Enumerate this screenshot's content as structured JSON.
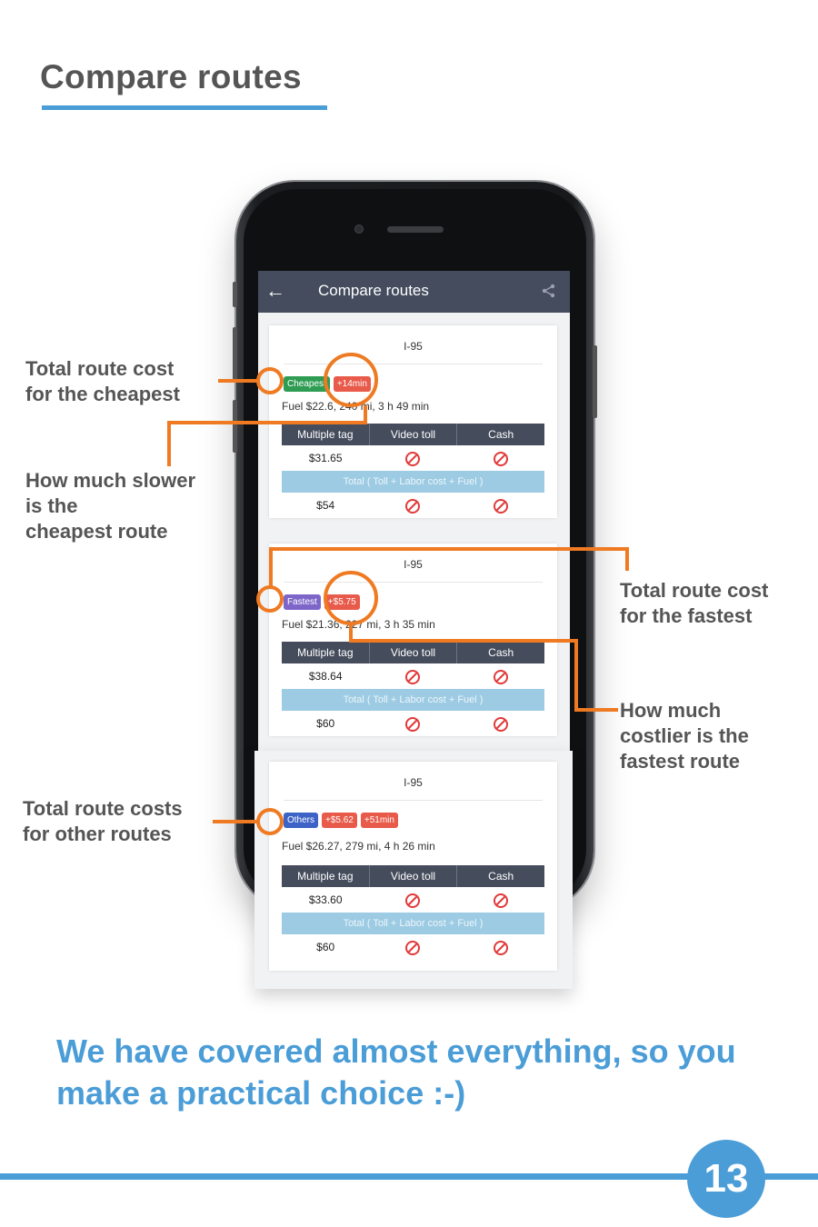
{
  "page": {
    "title": "Compare routes",
    "tagline": "We have covered almost everything, so you make a practical choice :-)",
    "page_number": "13"
  },
  "app": {
    "title": "Compare routes",
    "back_icon": "arrow-left-icon",
    "share_icon": "share-icon"
  },
  "table_headers": [
    "Multiple tag",
    "Video toll",
    "Cash"
  ],
  "total_band": "Total ( Toll + Labor cost + Fuel )",
  "routes": [
    {
      "road": "I-95",
      "badges": [
        {
          "label": "Cheapest",
          "color": "#2e9c53"
        },
        {
          "label": "+14min",
          "color": "#e85a4a"
        }
      ],
      "fuel": "Fuel $22.6, 240 mi, 3 h 49 min",
      "toll_multiple_tag": "$31.65",
      "total_multiple_tag": "$54"
    },
    {
      "road": "I-95",
      "badges": [
        {
          "label": "Fastest",
          "color": "#7e66c9"
        },
        {
          "label": "+$5.75",
          "color": "#e85a4a"
        }
      ],
      "fuel": "Fuel $21.36, 227 mi, 3 h 35 min",
      "toll_multiple_tag": "$38.64",
      "total_multiple_tag": "$60"
    },
    {
      "road": "I-95",
      "badges": [
        {
          "label": "Others",
          "color": "#3d63c7"
        },
        {
          "label": "+$5.62",
          "color": "#e85a4a"
        },
        {
          "label": "+51min",
          "color": "#e85a4a"
        }
      ],
      "fuel": "Fuel $26.27, 279 mi, 4 h 26 min",
      "toll_multiple_tag": "$33.60",
      "total_multiple_tag": "$60"
    }
  ],
  "annotations": {
    "cheapest_cost": "Total route cost\nfor the cheapest",
    "cheapest_slower": "How much slower\nis the\ncheapest route",
    "fastest_cost": "Total route cost\nfor the fastest",
    "fastest_costlier": "How much\ncostlier  is the\nfastest route",
    "other_cost": "Total route costs\nfor other routes"
  },
  "colors": {
    "accent_blue": "#4b9dd7",
    "annotation_orange": "#ef7a22",
    "appbar": "#444c5e"
  }
}
